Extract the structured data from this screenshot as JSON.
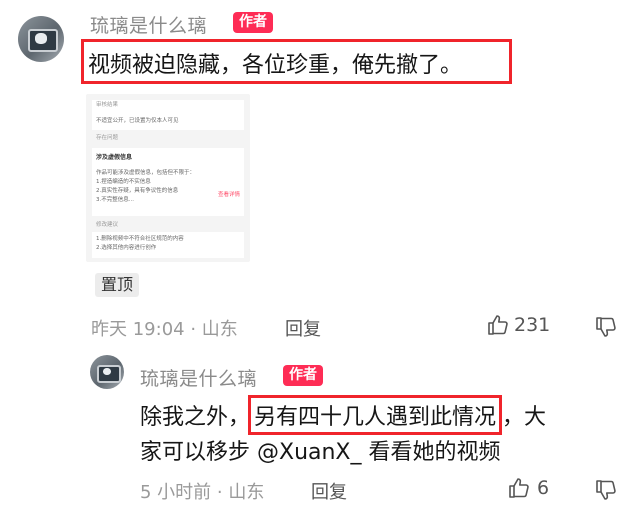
{
  "comment": {
    "username": "琉璃是什么璃",
    "author_badge": "作者",
    "text": "视频被迫隐藏，各位珍重，俺先撤了。",
    "attached_screenshot": {
      "section1_title": "审核结果",
      "section1_text": "不适宜公开，已设置为仅本人可见",
      "section2_title": "存在问题",
      "issue_title": "涉及虚假信息",
      "issue_desc": "作品可能涉及虚假信息，包括但不限于：",
      "issue_items": [
        "1.捏造编造的不实信息",
        "2.真实性存疑，具有争议性的信息",
        "3.不完整信息..."
      ],
      "view_details": "查看详情",
      "section3_title": "修改建议",
      "suggestions": [
        "1.删除视频中不符合社区规范的内容",
        "2.选择其他内容进行创作"
      ]
    },
    "pinned_label": "置顶",
    "time_location": "昨天 19:04 · 山东",
    "reply_label": "回复",
    "likes": "231"
  },
  "reply": {
    "username": "琉璃是什么璃",
    "author_badge": "作者",
    "line1_before": "除我之外，",
    "line1_highlight": "另有四十几人遇到此情况",
    "line1_after": "，大",
    "line2": "家可以移步 @XuanX_ 看看她的视频",
    "time_location": "5 小时前 · 山东",
    "reply_label": "回复",
    "likes": "6"
  },
  "icons": {
    "like": "thumbs-up-icon",
    "dislike": "thumbs-down-icon"
  },
  "colors": {
    "badge": "#fe2c55",
    "highlight_box": "#f0242b"
  }
}
